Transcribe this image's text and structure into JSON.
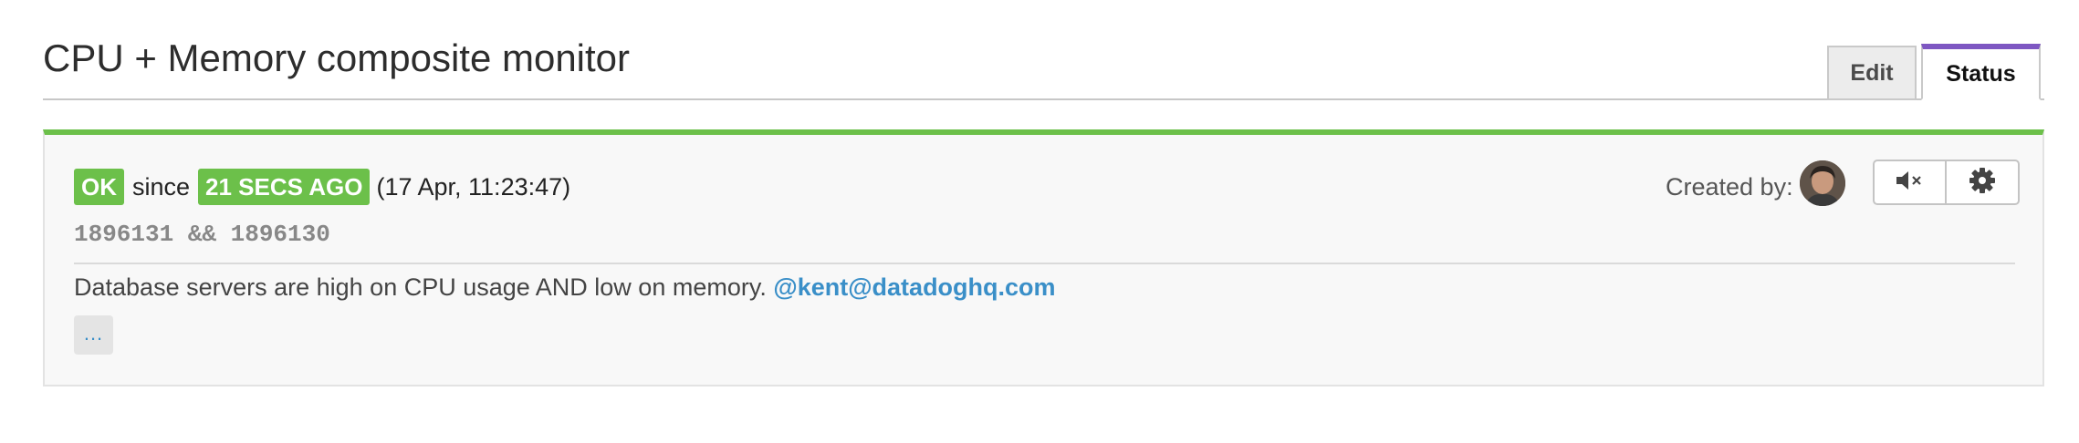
{
  "page": {
    "title": "CPU + Memory composite monitor"
  },
  "tabs": [
    {
      "label": "Edit",
      "active": false
    },
    {
      "label": "Status",
      "active": true
    }
  ],
  "monitor": {
    "status": "OK",
    "since_label": "since",
    "since_badge": "21 SECS AGO",
    "timestamp": "(17 Apr, 11:23:47)",
    "query": "1896131 && 1896130",
    "message": "Database servers are high on CPU usage AND low on memory.",
    "mention": "@kent@datadoghq.com",
    "more_label": "..."
  },
  "creator": {
    "label": "Created by:"
  },
  "actions": {
    "mute_icon": "mute-speaker-icon",
    "settings_icon": "gear-icon"
  },
  "colors": {
    "ok_green": "#6cc04a",
    "tab_accent": "#7e57c2",
    "link_blue": "#3a8fc8"
  }
}
